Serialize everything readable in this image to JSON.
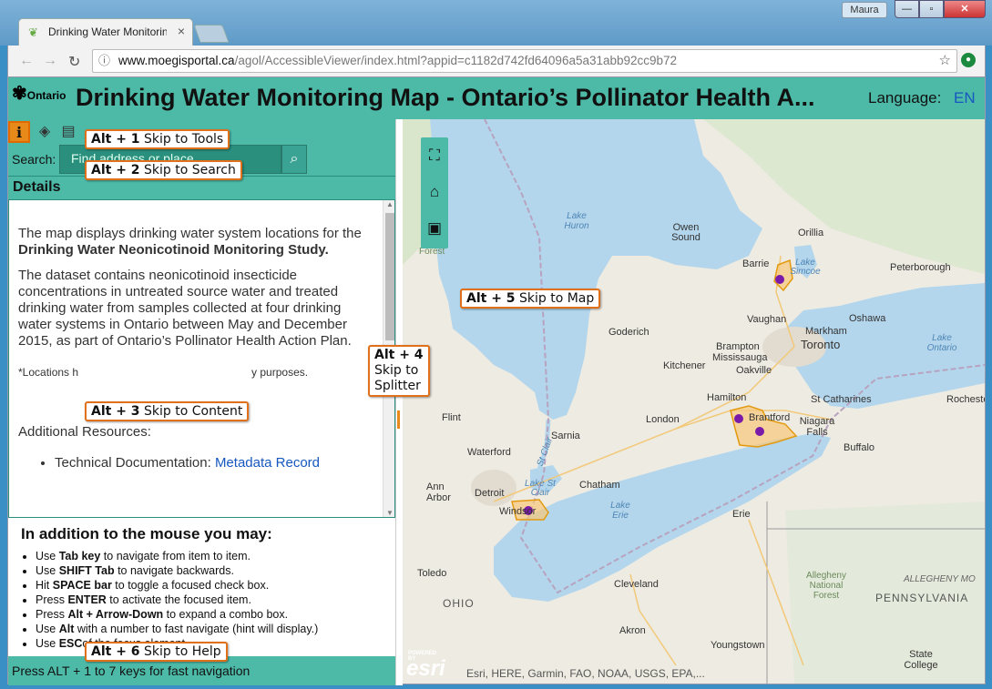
{
  "browser": {
    "tab_title": "Drinking Water Monitorin",
    "user": "Maura",
    "url_host": "www.moegisportal.ca",
    "url_path": "/agol/AccessibleViewer/index.html?appid=c1182d742fd64096a5a31abb92cc9b72"
  },
  "app": {
    "logo_text": "Ontario",
    "title": "Drinking Water Monitoring Map - Ontario’s Pollinator Health A...",
    "language_label": "Language:",
    "language_value": "EN"
  },
  "search": {
    "label": "Search:",
    "placeholder": "Find address or place"
  },
  "details": {
    "heading": "Details",
    "p1_pre": "The map displays drinking water system locations for the ",
    "p1_bold": "Drinking Water Neonicotinoid Monitoring Study.",
    "p2": "The dataset contains neonicotinoid insecticide concentrations in untreated source water and treated drinking water from samples collected at four drinking water systems in Ontario between May and December 2015, as part of Ontario’s Pollinator Health Action Plan.",
    "note_start": "*Locations h",
    "note_end": "y purposes.",
    "additional": "Additional Resources:",
    "resource_label": "Technical Documentation: ",
    "resource_link": "Metadata Record"
  },
  "help": {
    "heading": "In addition to the mouse you may:",
    "items": [
      {
        "pre": "Use ",
        "key": "Tab key",
        "post": " to navigate from item to item."
      },
      {
        "pre": "Use ",
        "key": "SHIFT Tab",
        "post": " to navigate backwards."
      },
      {
        "pre": "Hit ",
        "key": "SPACE bar",
        "post": " to toggle a focused check box."
      },
      {
        "pre": "Press ",
        "key": "ENTER",
        "post": " to activate the focused item."
      },
      {
        "pre": "Press ",
        "key": "Alt + Arrow-Down",
        "post": " to expand a combo box."
      },
      {
        "pre": "Use ",
        "key": "Alt",
        "post": " with a number to fast navigate (hint will display.)"
      },
      {
        "pre": "Use ",
        "key": "ESC",
        "post": "of the focus element."
      }
    ]
  },
  "status": "Press ALT + 1 to 7 keys for fast navigation",
  "hints": {
    "h1_key": "Alt + 1",
    "h1_text": " Skip to Tools",
    "h2_key": "Alt + 2",
    "h2_text": " Skip to Search",
    "h3_key": "Alt + 3",
    "h3_text": " Skip to Content",
    "h4_key": "Alt + 4",
    "h4_line1": "Skip to",
    "h4_line2": "Splitter",
    "h5_key": "Alt + 5",
    "h5_text": " Skip to Map",
    "h6_key": "Alt + 6",
    "h6_text": " Skip to Help"
  },
  "map": {
    "attribution": "Esri, HERE, Garmin, FAO, NOAA, USGS, EPA,...",
    "esri_small": "POWERED BY",
    "esri": "esri",
    "places": [
      "Owen Sound",
      "Orillia",
      "Barrie",
      "Peterborough",
      "Oshawa",
      "Vaughan",
      "Markham",
      "Toronto",
      "Brampton",
      "Mississauga",
      "Oakville",
      "Kitchener",
      "Goderich",
      "Hamilton",
      "St Catharines",
      "Niagara Falls",
      "Buffalo",
      "Rochester",
      "Brantford",
      "London",
      "Sarnia",
      "Flint",
      "Waterford",
      "Chatham",
      "Detroit",
      "Ann Arbor",
      "Windsor",
      "Erie",
      "Toledo",
      "Cleveland",
      "Akron",
      "Youngstown",
      "State College",
      "Forest",
      "OHIO",
      "PENNSYLVANIA",
      "ALLEGHENY MO",
      "Allegheny National Forest"
    ],
    "water": [
      "Lake Huron",
      "Lake Simcoe",
      "Lake Ontario",
      "Lake Erie",
      "Lake St Clair",
      "St Clair"
    ]
  },
  "colors": {
    "accent": "#4dbaa8",
    "hint_border": "#e0701a",
    "site_fill": "#f7c77a",
    "site_point": "#7a1aa8"
  },
  "icons": [
    "details-icon",
    "layers-icon",
    "legend-icon",
    "search-icon",
    "fullscreen-icon",
    "home-icon",
    "extent-icon"
  ]
}
